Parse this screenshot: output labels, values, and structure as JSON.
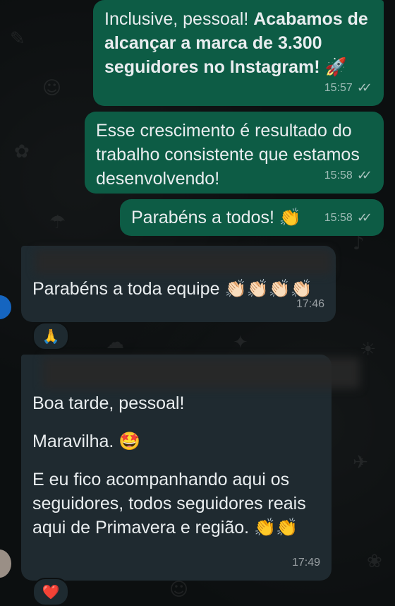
{
  "messages": [
    {
      "id": "m1",
      "direction": "outgoing",
      "text_plain": "Inclusive, pessoal! ",
      "text_bold": "Acabamos de alcançar a marca de 3.300 seguidores no Instagram!",
      "emoji": "🚀",
      "time": "15:57"
    },
    {
      "id": "m2",
      "direction": "outgoing",
      "text": "Esse crescimento é resultado do trabalho consistente que estamos desenvolvendo!",
      "time": "15:58"
    },
    {
      "id": "m3",
      "direction": "outgoing",
      "text": "Parabéns a todos!",
      "emoji": "👏",
      "time": "15:58"
    },
    {
      "id": "m4",
      "direction": "incoming",
      "text": "Parabéns a toda equipe",
      "emoji": "👏🏻👏🏻👏🏻👏🏻",
      "time": "17:46",
      "reaction": "🙏"
    },
    {
      "id": "m5",
      "direction": "incoming",
      "line1": "Boa tarde, pessoal!",
      "line2": "Maravilha.",
      "line2_emoji": "🤩",
      "line3": "E eu fico acompanhando aqui os seguidores, todos seguidores reais aqui de Primavera e região.",
      "line3_emoji": "👏👏",
      "time": "17:49",
      "reaction": "❤️"
    }
  ],
  "colors": {
    "outgoing_bubble": "#0d5c45",
    "incoming_bubble": "#1f2a30",
    "background": "#0c0f10",
    "text": "#e9edef"
  },
  "icons": {
    "read_receipt": "double-check-icon"
  }
}
